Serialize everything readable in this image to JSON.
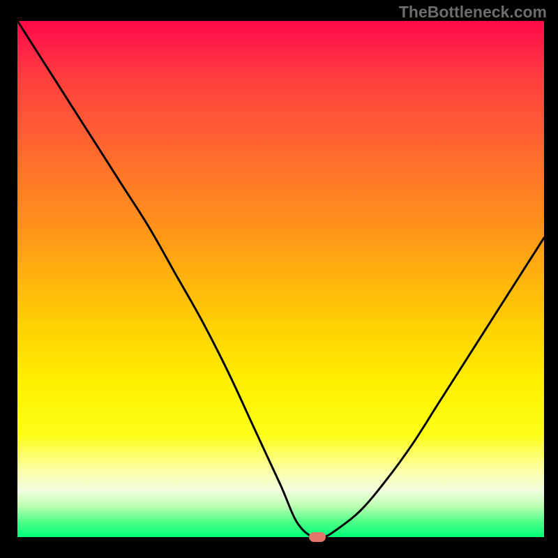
{
  "watermark": "TheBottleneck.com",
  "chart_data": {
    "type": "line",
    "title": "",
    "xlabel": "",
    "ylabel": "",
    "xlim": [
      0,
      100
    ],
    "ylim": [
      0,
      100
    ],
    "background_gradient": {
      "direction": "vertical",
      "stops": [
        {
          "pos": 0,
          "color": "#ff0a47"
        },
        {
          "pos": 50,
          "color": "#ffb40c"
        },
        {
          "pos": 80,
          "color": "#feff16"
        },
        {
          "pos": 100,
          "color": "#00ff78"
        }
      ]
    },
    "series": [
      {
        "name": "bottleneck-curve",
        "x": [
          0,
          5,
          10,
          15,
          20,
          25,
          30,
          35,
          40,
          45,
          50,
          53,
          56,
          58,
          60,
          65,
          70,
          75,
          80,
          85,
          90,
          95,
          100
        ],
        "y": [
          100,
          92,
          84,
          76,
          68,
          60,
          51,
          42,
          32,
          21,
          10,
          3,
          0,
          0,
          1,
          5,
          11,
          18,
          26,
          34,
          42,
          50,
          58
        ]
      }
    ],
    "marker": {
      "x": 57,
      "y": 0,
      "color": "#e2766c"
    }
  }
}
